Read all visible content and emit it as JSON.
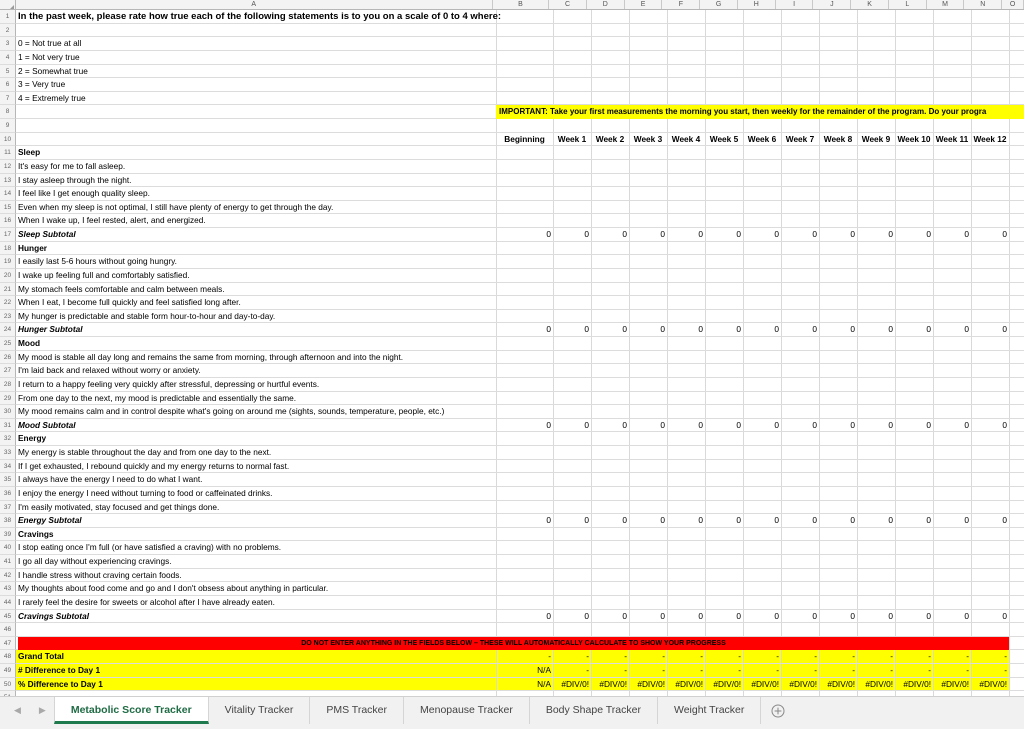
{
  "app": {
    "type": "spreadsheet"
  },
  "columns": {
    "letters": [
      "A",
      "B",
      "C",
      "D",
      "E",
      "F",
      "G",
      "H",
      "I",
      "J",
      "K",
      "L",
      "M",
      "N",
      "O"
    ],
    "widths": [
      480,
      57,
      38,
      38,
      38,
      38,
      38,
      38,
      38,
      38,
      38,
      38,
      38,
      38,
      22
    ]
  },
  "header_row": {
    "label_col_a": "",
    "periods": [
      "Beginning",
      "Week 1",
      "Week 2",
      "Week 3",
      "Week 4",
      "Week 5",
      "Week 6",
      "Week 7",
      "Week 8",
      "Week 9",
      "Week 10",
      "Week 11",
      "Week 12"
    ]
  },
  "intro": {
    "title": "In the past week, please rate how true each of the following statements is to you on a scale of 0 to 4 where:",
    "scale": [
      "0 = Not true at all",
      "1 = Not very true",
      "2 = Somewhat true",
      "3 = Very true",
      "4 = Extremely true"
    ]
  },
  "important_note": "IMPORTANT:  Take your first measurements the morning you start, then weekly for the remainder of the program. Do your progra",
  "warning_banner": "DO NOT ENTER ANYTHING IN THE FIELDS BELOW – THESE WILL AUTOMATICALLY CALCULATE TO SHOW YOUR PROGRESS",
  "sections": [
    {
      "name": "Sleep",
      "statements": [
        "It's easy for me to fall asleep.",
        "I stay asleep through the night.",
        "I feel like I get enough quality sleep.",
        "Even when my sleep is not optimal, I still have plenty of energy to get through the day.",
        "When I wake up, I feel rested, alert, and energized."
      ],
      "subtotal_label": "Sleep Subtotal",
      "subtotal_values": [
        "0",
        "0",
        "0",
        "0",
        "0",
        "0",
        "0",
        "0",
        "0",
        "0",
        "0",
        "0",
        "0"
      ]
    },
    {
      "name": "Hunger",
      "statements": [
        "I easily last 5-6 hours without going hungry.",
        "I wake up feeling full and comfortably satisfied.",
        "My stomach feels comfortable and calm between meals.",
        "When I eat, I become full quickly and feel satisfied long after.",
        "My hunger is predictable and stable form hour-to-hour and day-to-day."
      ],
      "subtotal_label": "Hunger Subtotal",
      "subtotal_values": [
        "0",
        "0",
        "0",
        "0",
        "0",
        "0",
        "0",
        "0",
        "0",
        "0",
        "0",
        "0",
        "0"
      ]
    },
    {
      "name": "Mood",
      "statements": [
        "My mood is stable all day long and remains the same from morning, through afternoon and into the night.",
        "I'm laid back and relaxed without worry or anxiety.",
        "I return to a happy feeling very quickly after stressful, depressing or hurtful events.",
        "From one day to the next, my mood is predictable and essentially the same.",
        "My mood remains calm and in control despite what's going on around me (sights, sounds, temperature, people, etc.)"
      ],
      "subtotal_label": "Mood Subtotal",
      "subtotal_values": [
        "0",
        "0",
        "0",
        "0",
        "0",
        "0",
        "0",
        "0",
        "0",
        "0",
        "0",
        "0",
        "0"
      ]
    },
    {
      "name": "Energy",
      "statements": [
        "My energy is stable throughout the day and from one day to the next.",
        "If I get exhausted, I rebound quickly and my energy returns to normal fast.",
        "I always have the energy I need to do what I want.",
        "I enjoy the energy I need without turning to food or caffeinated drinks.",
        "I'm easily motivated, stay focused and get things done."
      ],
      "subtotal_label": "Energy Subtotal",
      "subtotal_values": [
        "0",
        "0",
        "0",
        "0",
        "0",
        "0",
        "0",
        "0",
        "0",
        "0",
        "0",
        "0",
        "0"
      ]
    },
    {
      "name": "Cravings",
      "statements": [
        "I stop eating once I'm full (or have satisfied a craving) with no problems.",
        "I go all day without experiencing cravings.",
        "I handle stress without craving certain foods.",
        "My thoughts about food come and go and I don't obsess about anything in particular.",
        "I rarely feel the desire for sweets or alcohol after I have already eaten."
      ],
      "subtotal_label": "Cravings Subtotal",
      "subtotal_values": [
        "0",
        "0",
        "0",
        "0",
        "0",
        "0",
        "0",
        "0",
        "0",
        "0",
        "0",
        "0",
        "0"
      ]
    }
  ],
  "totals": [
    {
      "label": "Grand Total",
      "values": [
        "-",
        "-",
        "-",
        "-",
        "-",
        "-",
        "-",
        "-",
        "-",
        "-",
        "-",
        "-",
        "-"
      ]
    },
    {
      "label": " # Difference to Day 1",
      "values": [
        "N/A",
        "-",
        "-",
        "-",
        "-",
        "-",
        "-",
        "-",
        "-",
        "-",
        "-",
        "-",
        "-"
      ]
    },
    {
      "label": "% Difference to Day 1",
      "values": [
        "N/A",
        "#DIV/0!",
        "#DIV/0!",
        "#DIV/0!",
        "#DIV/0!",
        "#DIV/0!",
        "#DIV/0!",
        "#DIV/0!",
        "#DIV/0!",
        "#DIV/0!",
        "#DIV/0!",
        "#DIV/0!",
        "#DIV/0!"
      ]
    }
  ],
  "row_numbers": [
    "1",
    "2",
    "3",
    "4",
    "5",
    "6",
    "7",
    "8",
    "9",
    "10",
    "11",
    "12",
    "13",
    "14",
    "15",
    "16",
    "17",
    "18",
    "19",
    "20",
    "21",
    "22",
    "23",
    "24",
    "25",
    "26",
    "27",
    "28",
    "29",
    "30",
    "31",
    "32",
    "33",
    "34",
    "35",
    "36",
    "37",
    "38",
    "39",
    "40",
    "41",
    "42",
    "43",
    "44",
    "45",
    "46",
    "47",
    "48",
    "49",
    "50",
    "51"
  ],
  "sheet_tabs": {
    "prev_label": "◀",
    "next_label": "▶",
    "items": [
      {
        "label": "Metabolic Score Tracker",
        "active": true
      },
      {
        "label": "Vitality Tracker",
        "active": false
      },
      {
        "label": "PMS Tracker",
        "active": false
      },
      {
        "label": "Menopause Tracker",
        "active": false
      },
      {
        "label": "Body Shape Tracker",
        "active": false
      },
      {
        "label": "Weight Tracker",
        "active": false
      }
    ],
    "add_sheet_icon": "plus-circle-icon"
  },
  "colors": {
    "highlight_yellow": "#ffff00",
    "warning_red": "#ff0000",
    "active_tab_green": "#1f7a4d",
    "header_gray": "#f3f3f3"
  }
}
